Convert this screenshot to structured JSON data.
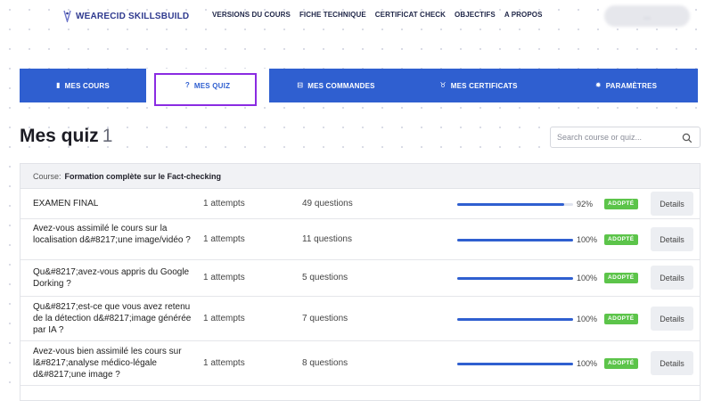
{
  "header": {
    "logo_prefix": "WEARECID",
    "logo_suffix": "SKILLSBUILD",
    "nav": [
      "VERSIONS DU COURS",
      "FICHE TECHNIQUE",
      "CERTIFICAT CHECK",
      "OBJECTIFS",
      "A PROPOS"
    ],
    "account_label": "..."
  },
  "tabs": [
    {
      "label": "MES COURS",
      "icon": "book-icon",
      "glyph": "▮"
    },
    {
      "label": "MES QUIZ",
      "icon": "question-icon",
      "glyph": "?"
    },
    {
      "label": "MES COMMANDES",
      "icon": "basket-icon",
      "glyph": "⊟"
    },
    {
      "label": "MES CERTIFICATS",
      "icon": "award-icon",
      "glyph": "♉"
    },
    {
      "label": "PARAMÈTRES",
      "icon": "gear-icon",
      "glyph": "✹"
    }
  ],
  "page": {
    "title": "Mes quiz",
    "count": "1"
  },
  "search": {
    "placeholder": "Search course or quiz..."
  },
  "course": {
    "label": "Course:",
    "name": "Formation complète sur le Fact-checking"
  },
  "quizzes": [
    {
      "name": "EXAMEN FINAL",
      "attempts": "1 attempts",
      "questions": "49 questions",
      "progress": 92,
      "percent": "92%",
      "status": "ADOPTÉ",
      "action": "Details"
    },
    {
      "name": "Avez-vous assimilé le cours sur la localisation d&#8217;une image/vidéo ?",
      "attempts": "1 attempts",
      "questions": "11 questions",
      "progress": 100,
      "percent": "100%",
      "status": "ADOPTÉ",
      "action": "Details"
    },
    {
      "name": "Qu&#8217;avez-vous appris du Google Dorking ?",
      "attempts": "1 attempts",
      "questions": "5 questions",
      "progress": 100,
      "percent": "100%",
      "status": "ADOPTÉ",
      "action": "Details"
    },
    {
      "name": "Qu&#8217;est-ce que vous avez retenu de la détection d&#8217;image générée par IA ?",
      "attempts": "1 attempts",
      "questions": "7 questions",
      "progress": 100,
      "percent": "100%",
      "status": "ADOPTÉ",
      "action": "Details"
    },
    {
      "name": "Avez-vous bien assimilé les cours sur l&#8217;analyse médico-légale d&#8217;une image ?",
      "attempts": "1 attempts",
      "questions": "8 questions",
      "progress": 100,
      "percent": "100%",
      "status": "ADOPTÉ",
      "action": "Details"
    }
  ],
  "colors": {
    "primary": "#2f5fd0",
    "success": "#5cc44a",
    "focus": "#8a2be2"
  }
}
